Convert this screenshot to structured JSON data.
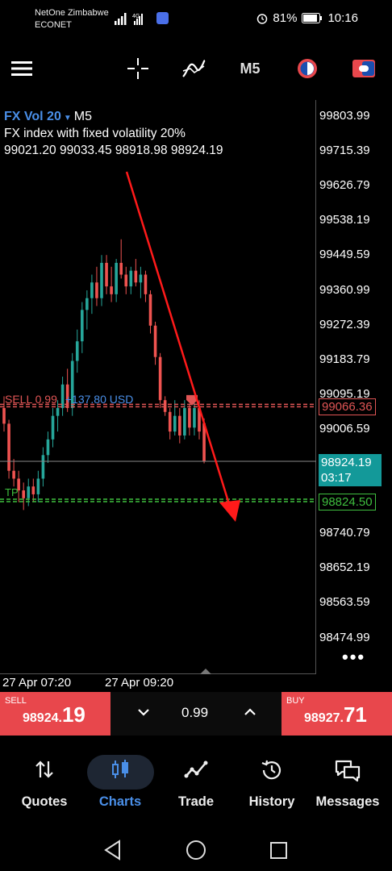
{
  "status_bar": {
    "carrier1": "NetOne Zimbabwe",
    "carrier2": "ECONET",
    "battery": "81%",
    "time": "10:16"
  },
  "toolbar": {
    "items": [
      "menu-icon",
      "crosshair-icon",
      "indicators-icon",
      "timeframe",
      "one-click-trading-icon",
      "account-icon"
    ],
    "timeframe": "M5"
  },
  "chart": {
    "symbol": "FX Vol 20",
    "timeframe": "M5",
    "description": "FX index with fixed volatility 20%",
    "ohlc": "99021.20 99033.45 98918.98 98924.19",
    "price_scale": [
      "99803.99",
      "99715.39",
      "99626.79",
      "99538.19",
      "99449.59",
      "99360.99",
      "99272.39",
      "99183.79",
      "99095.19",
      "99006.59",
      "98740.79",
      "98652.19",
      "98563.59",
      "98474.99"
    ],
    "sell_order_label": "SELL 0.99",
    "sell_order_pl": "+137.80 USD",
    "sell_order_price": "99066.36",
    "current_price": "98924.19",
    "bar_timer": "03:17",
    "tp_label": "TP",
    "tp_price": "98824.50",
    "time_labels": [
      "27 Apr 07:20",
      "27 Apr 09:20"
    ],
    "colors": {
      "bull": "#26a69a",
      "bear": "#ef5350",
      "sell_line": "#e05555",
      "tp_line": "#3fbf3f",
      "arrow": "#ff1a1a"
    }
  },
  "chart_data": {
    "type": "candlestick",
    "title": "FX Vol 20, M5",
    "ylim": [
      98430,
      99850
    ],
    "candles": [
      {
        "o": 99060,
        "h": 99090,
        "l": 99000,
        "c": 99020
      },
      {
        "o": 99020,
        "h": 99030,
        "l": 98880,
        "c": 98900
      },
      {
        "o": 98900,
        "h": 98930,
        "l": 98860,
        "c": 98880
      },
      {
        "o": 98880,
        "h": 98900,
        "l": 98820,
        "c": 98850
      },
      {
        "o": 98850,
        "h": 98870,
        "l": 98800,
        "c": 98830
      },
      {
        "o": 98830,
        "h": 98880,
        "l": 98810,
        "c": 98860
      },
      {
        "o": 98860,
        "h": 98880,
        "l": 98820,
        "c": 98840
      },
      {
        "o": 98840,
        "h": 98900,
        "l": 98820,
        "c": 98880
      },
      {
        "o": 98880,
        "h": 98960,
        "l": 98860,
        "c": 98940
      },
      {
        "o": 98940,
        "h": 99000,
        "l": 98920,
        "c": 98980
      },
      {
        "o": 98980,
        "h": 99060,
        "l": 98960,
        "c": 99040
      },
      {
        "o": 99040,
        "h": 99080,
        "l": 99000,
        "c": 99060
      },
      {
        "o": 99060,
        "h": 99140,
        "l": 99040,
        "c": 99120
      },
      {
        "o": 99120,
        "h": 99160,
        "l": 99050,
        "c": 99060
      },
      {
        "o": 99060,
        "h": 99200,
        "l": 99040,
        "c": 99180
      },
      {
        "o": 99180,
        "h": 99260,
        "l": 99150,
        "c": 99230
      },
      {
        "o": 99230,
        "h": 99330,
        "l": 99200,
        "c": 99310
      },
      {
        "o": 99310,
        "h": 99360,
        "l": 99260,
        "c": 99340
      },
      {
        "o": 99340,
        "h": 99400,
        "l": 99300,
        "c": 99380
      },
      {
        "o": 99380,
        "h": 99420,
        "l": 99320,
        "c": 99340
      },
      {
        "o": 99340,
        "h": 99450,
        "l": 99320,
        "c": 99430
      },
      {
        "o": 99430,
        "h": 99450,
        "l": 99350,
        "c": 99370
      },
      {
        "o": 99370,
        "h": 99420,
        "l": 99330,
        "c": 99350
      },
      {
        "o": 99350,
        "h": 99440,
        "l": 99330,
        "c": 99430
      },
      {
        "o": 99430,
        "h": 99490,
        "l": 99390,
        "c": 99400
      },
      {
        "o": 99400,
        "h": 99420,
        "l": 99350,
        "c": 99370
      },
      {
        "o": 99370,
        "h": 99420,
        "l": 99350,
        "c": 99410
      },
      {
        "o": 99410,
        "h": 99440,
        "l": 99370,
        "c": 99380
      },
      {
        "o": 99380,
        "h": 99420,
        "l": 99340,
        "c": 99400
      },
      {
        "o": 99400,
        "h": 99410,
        "l": 99330,
        "c": 99350
      },
      {
        "o": 99350,
        "h": 99360,
        "l": 99250,
        "c": 99270
      },
      {
        "o": 99270,
        "h": 99280,
        "l": 99170,
        "c": 99190
      },
      {
        "o": 99190,
        "h": 99200,
        "l": 99060,
        "c": 99080
      },
      {
        "o": 99080,
        "h": 99090,
        "l": 99040,
        "c": 99050
      },
      {
        "o": 99050,
        "h": 99060,
        "l": 98980,
        "c": 99000
      },
      {
        "o": 99000,
        "h": 99080,
        "l": 98990,
        "c": 99040
      },
      {
        "o": 99040,
        "h": 99060,
        "l": 98970,
        "c": 98990
      },
      {
        "o": 98990,
        "h": 99080,
        "l": 98980,
        "c": 99060
      },
      {
        "o": 99060,
        "h": 99070,
        "l": 98990,
        "c": 99010
      },
      {
        "o": 99010,
        "h": 99080,
        "l": 98990,
        "c": 99060
      },
      {
        "o": 99060,
        "h": 99080,
        "l": 98980,
        "c": 99000
      },
      {
        "o": 99021.2,
        "h": 99033.45,
        "l": 98918.98,
        "c": 98924.19
      }
    ],
    "levels": {
      "sell_order": 99066.36,
      "current": 98924.19,
      "take_profit": 98824.5
    }
  },
  "trade_bar": {
    "sell_tag": "SELL",
    "sell_small": "98924.",
    "sell_big": "19",
    "buy_tag": "BUY",
    "buy_small": "98927.",
    "buy_big": "71",
    "volume": "0.99"
  },
  "bottom_nav": {
    "items": [
      {
        "label": "Quotes",
        "icon": "quotes-icon"
      },
      {
        "label": "Charts",
        "icon": "charts-icon",
        "active": true
      },
      {
        "label": "Trade",
        "icon": "trade-icon"
      },
      {
        "label": "History",
        "icon": "history-icon"
      },
      {
        "label": "Messages",
        "icon": "messages-icon"
      }
    ],
    "active_color": "#4a8fe8"
  }
}
